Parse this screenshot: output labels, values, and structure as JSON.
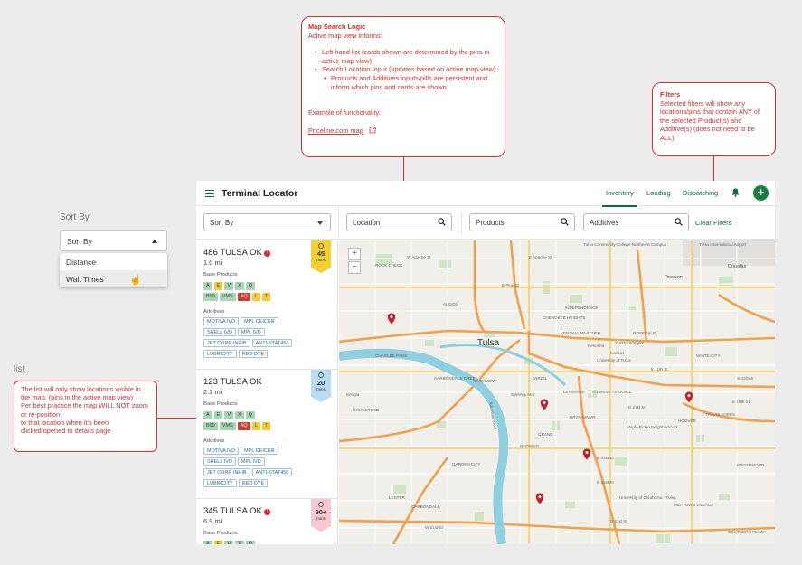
{
  "map_logic_note": {
    "title": "Map Search Logic",
    "intro": "Active map view informs:",
    "bullets": [
      "Left hand list (cards shown are determined by the pins in active map view)",
      "Search Location Input (updates based on active map view)"
    ],
    "sub_bullet": "Products and Additives inputs/pills are persistent and inform which pins and cards are shown",
    "example_label": "Example of functionality:",
    "example_link": "Priceline.com map"
  },
  "filters_note": {
    "title": "Filters",
    "body": "Selected filters will show any locations/pins that contain ANY of the selected Product(s) and Additive(s) (does not need to be ALL)"
  },
  "list_note": {
    "lines": [
      "The list will only show locations visible in the map. (pins in the active map view)",
      "Per best practice the map WILL NOT zoom or re-position",
      "to that location when it's been clicked/opened to details page"
    ]
  },
  "sort_demo": {
    "heading": "Sort By",
    "select_label": "Sort By",
    "options": [
      "Distance",
      "Wait Times"
    ]
  },
  "list_heading": "list",
  "app": {
    "title": "Terminal Locator",
    "nav": [
      "Inventory",
      "Loading",
      "Dispatching"
    ],
    "active_nav": "Inventory",
    "sort_label": "Sort By",
    "location_placeholder": "Location",
    "products_placeholder": "Products",
    "additives_placeholder": "Additives",
    "clear_filters": "Clear Filters",
    "accent": "#0e6b3b",
    "cards": [
      {
        "name": "486 TULSA OK",
        "alert": true,
        "distance": "1.0 mi",
        "wait": "45",
        "wait_unit": "mins",
        "badge_color": "yellow",
        "base_products_label": "Base Products",
        "products_row1": [
          [
            "A",
            "g"
          ],
          [
            "E",
            "y"
          ],
          [
            "V",
            "g"
          ],
          [
            "X",
            "g"
          ],
          [
            "Q",
            "g"
          ]
        ],
        "products_row2": [
          [
            "B99",
            "g"
          ],
          [
            "VMS",
            "g"
          ],
          [
            "AQ",
            "r"
          ],
          [
            "L",
            "y"
          ],
          [
            "T",
            "y"
          ]
        ],
        "additives_label": "Additives",
        "additives": [
          [
            "MOTIVA IVD",
            "MPL DEICER"
          ],
          [
            "SHELL IVD",
            "MPL IVD"
          ],
          [
            "JET CORR INHIB",
            "ANTI-STAT450"
          ],
          [
            "LUBRICITY",
            "RED DYE"
          ]
        ]
      },
      {
        "name": "123 TULSA OK",
        "alert": false,
        "distance": "2.3 mi",
        "wait": "20",
        "wait_unit": "mins",
        "badge_color": "blue",
        "base_products_label": "Base Products",
        "products_row1": [
          [
            "A",
            "g"
          ],
          [
            "E",
            "g"
          ],
          [
            "V",
            "g"
          ],
          [
            "X",
            "g"
          ],
          [
            "Q",
            "g"
          ]
        ],
        "products_row2": [
          [
            "B99",
            "g"
          ],
          [
            "VMS",
            "g"
          ],
          [
            "AQ",
            "r"
          ],
          [
            "L",
            "y"
          ],
          [
            "T",
            "y"
          ]
        ],
        "additives_label": "Additives",
        "additives": [
          [
            "MOTIVA IVD",
            "MPL DEICER"
          ],
          [
            "SHELL IVD",
            "MPL IVD"
          ],
          [
            "JET CORR INHIB",
            "ANTI-STAT450"
          ],
          [
            "LUBRICITY",
            "RED DYE"
          ]
        ]
      },
      {
        "name": "345 TULSA OK",
        "alert": true,
        "distance": "6.9 mi",
        "wait": "90+",
        "wait_unit": "mins",
        "badge_color": "pink",
        "base_products_label": "Base Products",
        "products_row1": [
          [
            "A",
            "g"
          ],
          [
            "E",
            "y"
          ],
          [
            "V",
            "g"
          ],
          [
            "X",
            "g"
          ],
          [
            "Q",
            "g"
          ]
        ]
      }
    ]
  },
  "map": {
    "city_label": "Tulsa",
    "zoom_in": "+",
    "zoom_out": "−",
    "labels": [
      "Tulsa Community College Northeast Campus",
      "Tulsa International Airport",
      "Douglas",
      "Dawson",
      "KENDALL WHITTIER",
      "CHEROKEE HEIGHTS",
      "INDEPENDENCE",
      "ROSEDALE",
      "Kenosha",
      "Kansas",
      "TURNER PARK",
      "University of Tulsa",
      "LENWOOD",
      "SUNRISE TERRACE",
      "WHITE CITY",
      "BRYN MAWR",
      "CHARLES PAGE",
      "Kengia",
      "RIVERVIEW",
      "ALISON",
      "SWAN LAKE",
      "Maple Ridge Neighborhood",
      "HOOVER",
      "TRAVIS ACRES",
      "BROADMOOR",
      "GARDEN CITY",
      "ROCK CREEK",
      "CARBONDALE",
      "LESTER",
      "University of Oklahoma - Tulsa",
      "MID-TOWN VILLAGE",
      "SOUTHERN PLAZA",
      "CARBONDALE CREEK",
      "HOMESTEAD",
      "VIRGIL",
      "GRAND",
      "REDDING",
      "SADDLE",
      "E Pine St",
      "E Apache St",
      "W Apache St",
      "E 11th St",
      "E 15th St",
      "E 21st St",
      "E 31st St",
      "E 41st St",
      "E 51st St",
      "W 51st St",
      "Arkansas River"
    ]
  }
}
